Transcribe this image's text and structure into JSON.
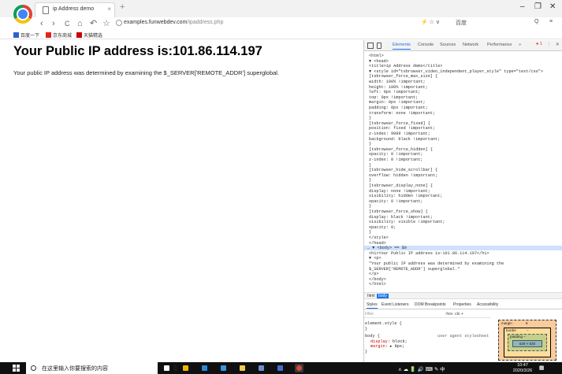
{
  "browser": {
    "tab_title": "ip Address demo",
    "tab_close": "×",
    "new_tab": "+",
    "window_controls": [
      "–",
      "❐",
      "✕"
    ],
    "nav": {
      "back": "‹",
      "forward": "›",
      "reload": "C",
      "home": "⌂",
      "undo": "↶",
      "bookmark_star": "☆"
    },
    "url_host": "examples.funwebdev.com",
    "url_path": "/ipaddress.php",
    "toolbar_right": [
      "⚡ ☆ ∨",
      "百度",
      "Q",
      "≡"
    ],
    "bookmarks": [
      {
        "label": "百度一下",
        "color": "#2f5fd0"
      },
      {
        "label": "京东商城",
        "color": "#e1251b"
      },
      {
        "label": "天猫精选",
        "color": "#c40000"
      }
    ]
  },
  "page": {
    "heading": "Your Public IP address is:101.86.114.197",
    "paragraph": "Your public IP address was determined by examining the $_SERVER['REMOTE_ADDR'] superglobal."
  },
  "devtools": {
    "tabs": [
      "Elements",
      "Console",
      "Sources",
      "Network",
      "Performance",
      "»"
    ],
    "active_tab": "Elements",
    "error_badge": "● 1",
    "more_menu": "⋮",
    "close": "✕",
    "code_lines": [
      "<html>",
      "▼ <head>",
      "    <title>ip Address demo</title>",
      "  ▼ <style id=\"tsbrowser_video_independent_player_style\" type=\"text/css\">",
      "        [tsbrowser_force_max_size] {",
      "          width: 100% !important;",
      "          height: 100% !important;",
      "          left: 0px !important;",
      "          top: 0px !important;",
      "          margin: 0px !important;",
      "          padding: 0px !important;",
      "          transform: none !important;",
      "        }",
      "        [tsbrowser_force_fixed] {",
      "          position: fixed !important;",
      "          z-index: 9999 !important;",
      "          background: black !important;",
      "        }",
      "        [tsbrowser_force_hidden] {",
      "          opacity: 0 !important;",
      "          z-index: 0 !important;",
      "        }",
      "        [tsbrowser_hide_scrollbar] {",
      "          overflow: hidden !important;",
      "        }",
      "        [tsbrowser_display_none] {",
      "          display: none !important;",
      "          visibility: hidden !important;",
      "          opacity: 0 !important;",
      "        }",
      "        [tsbrowser_force_show] {",
      "          display: black !important;",
      "          visibility: visible !important;",
      "          opacity: 0;",
      "        }",
      "    </style>",
      "  </head>",
      "… ▼ <body> == $0",
      "    <h1>Your Public IP address is:101.86.114.197</h1>",
      "  ▼ <p>",
      "      \"Your public IP address was determined by examining the",
      "      $_SERVER['REMOTE_ADDR'] superglobal.\"",
      "    </p>",
      "  </body>",
      "</html>"
    ],
    "selected_line": 37,
    "breadcrumbs": [
      "html",
      "body"
    ],
    "active_breadcrumb": "body",
    "styles_tabs": [
      "Styles",
      "Event Listeners",
      "DOM Breakpoints",
      "Properties",
      "Accessibility"
    ],
    "filter_placeholder": "Filter",
    "filter_options": ":hov  .cls  +",
    "element_style_lines": [
      "element.style {",
      "}"
    ],
    "body_rule": {
      "selector": "body {",
      "source": "user agent stylesheet",
      "props": [
        {
          "name": "display",
          "value": "block;"
        },
        {
          "name": "margin",
          "value": "▸ 8px;"
        }
      ],
      "close": "}"
    },
    "box_model": {
      "margin_label": "margin",
      "margin_value": "8",
      "border_label": "border",
      "border_value": "–",
      "padding_label": "padding –",
      "content": "629 × 630"
    }
  },
  "taskbar": {
    "search_text": "在这里输入你要搜索的内容",
    "mic": "🎙",
    "apps": [
      {
        "name": "task-view",
        "color": "#ffffff"
      },
      {
        "name": "store",
        "color": "#f0b400"
      },
      {
        "name": "mail",
        "color": "#2b88d8"
      },
      {
        "name": "edge",
        "color": "#3a96dd"
      },
      {
        "name": "explorer",
        "color": "#f2c94c"
      },
      {
        "name": "photos",
        "color": "#6b8fd6"
      },
      {
        "name": "app",
        "color": "#4a6bd0"
      },
      {
        "name": "chrome",
        "color": "#db4437"
      }
    ],
    "tray_icons": "⋏  ☁  🔋  🔊  ⌨  ✎  中",
    "time": "10:47",
    "date": "2020/3/26"
  }
}
